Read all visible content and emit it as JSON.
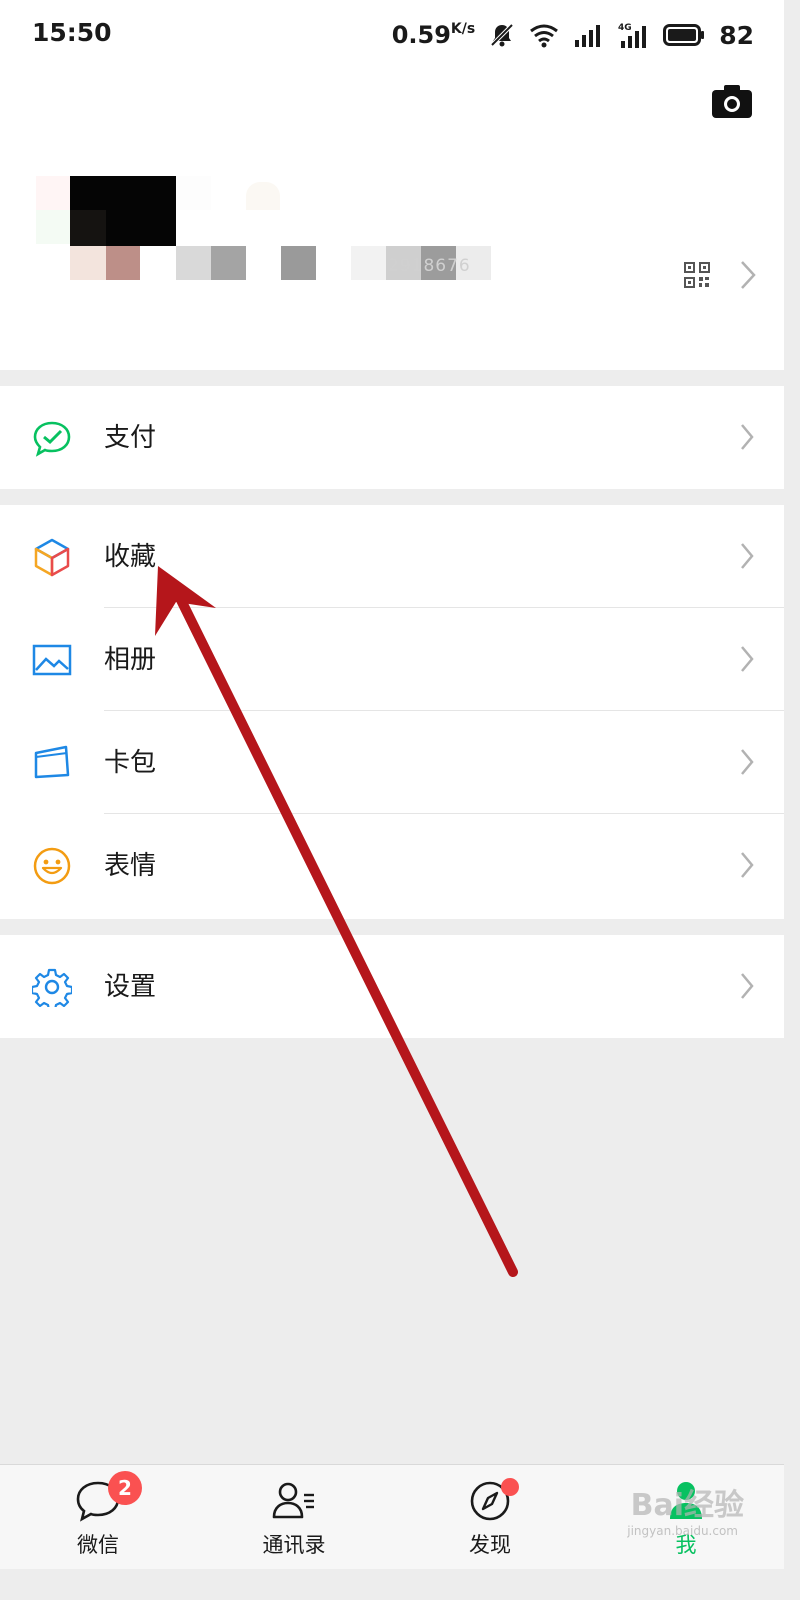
{
  "status_bar": {
    "time": "15:50",
    "net_speed": "0.59",
    "net_unit": "K/s",
    "network": "4G",
    "battery": "82"
  },
  "profile": {
    "camera_icon": "camera-icon",
    "qr_icon": "qr-code-icon",
    "wechat_id_partial": "2918676"
  },
  "menu": {
    "groups": [
      [
        {
          "label": "支付",
          "icon": "wallet-check-icon",
          "color": "#07c160"
        }
      ],
      [
        {
          "label": "收藏",
          "icon": "cube-icon",
          "color": "#f5a623"
        },
        {
          "label": "相册",
          "icon": "photo-icon",
          "color": "#1e88e5"
        },
        {
          "label": "卡包",
          "icon": "card-wallet-icon",
          "color": "#1e88e5"
        },
        {
          "label": "表情",
          "icon": "smiley-icon",
          "color": "#f39c12"
        }
      ],
      [
        {
          "label": "设置",
          "icon": "gear-icon",
          "color": "#1e88e5"
        }
      ]
    ]
  },
  "tabbar": {
    "tabs": [
      {
        "label": "微信",
        "icon": "chat-bubble-icon",
        "badge": "2"
      },
      {
        "label": "通讯录",
        "icon": "contacts-icon"
      },
      {
        "label": "发现",
        "icon": "compass-icon"
      },
      {
        "label": "我",
        "icon": "person-icon",
        "active": true
      }
    ]
  },
  "watermark": {
    "main": "Bai经验",
    "sub": "jingyan.baidu.com"
  },
  "colors": {
    "accent": "#07c160",
    "badge": "#fa5151",
    "annotation_arrow": "#b5161b"
  }
}
